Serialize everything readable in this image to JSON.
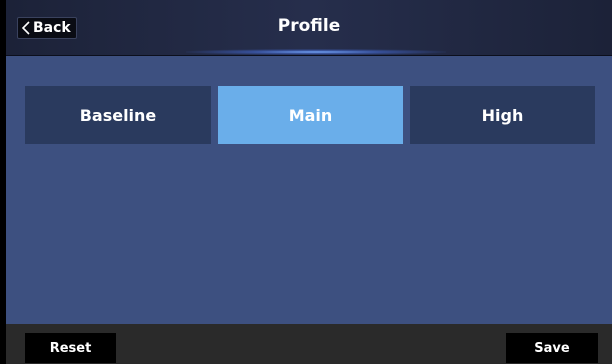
{
  "header": {
    "title": "Profile",
    "back_label": "Back",
    "back_icon": "chevron-left-icon"
  },
  "profile_options": [
    {
      "label": "Baseline",
      "selected": false
    },
    {
      "label": "Main",
      "selected": true
    },
    {
      "label": "High",
      "selected": false
    }
  ],
  "footer": {
    "reset_label": "Reset",
    "save_label": "Save"
  },
  "colors": {
    "content_background": "#3d5080",
    "segment_default": "#2a3a5e",
    "segment_selected": "#6aaeea",
    "footer_background": "#2a2a2a",
    "header_background": "#262e4c"
  }
}
